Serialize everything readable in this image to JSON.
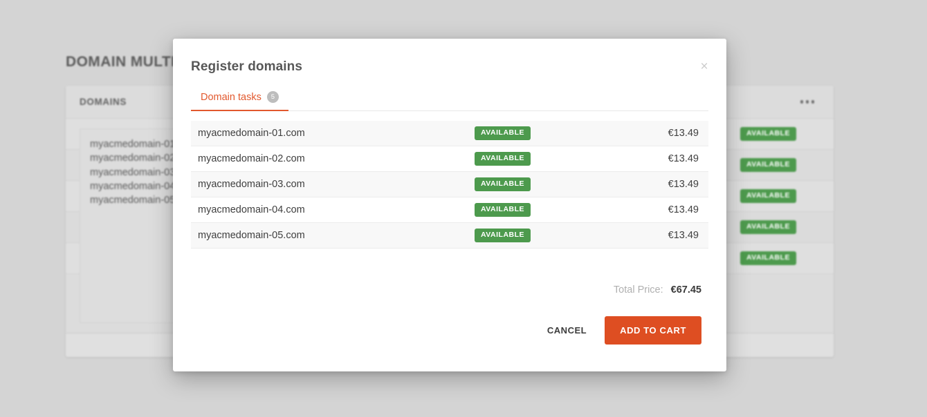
{
  "background": {
    "page_title": "DOMAIN MULTISEARCH",
    "card": {
      "header_title": "DOMAINS",
      "menu_icon": "ellipsis-horizontal-icon",
      "textarea_value": "myacmedomain-01.com\nmyacmedomain-02.com\nmyacmedomain-03.com\nmyacmedomain-04.com\nmyacmedomain-05.com",
      "rows": [
        {
          "status": "AVAILABLE"
        },
        {
          "status": "AVAILABLE"
        },
        {
          "status": "AVAILABLE"
        },
        {
          "status": "AVAILABLE"
        },
        {
          "status": "AVAILABLE"
        }
      ]
    }
  },
  "modal": {
    "title": "Register domains",
    "close_icon": "close-icon",
    "close_label": "×",
    "tabs": [
      {
        "label": "Domain tasks",
        "badge": "5",
        "active": true
      }
    ],
    "table": {
      "rows": [
        {
          "domain": "myacmedomain-01.com",
          "status": "AVAILABLE",
          "price": "€13.49"
        },
        {
          "domain": "myacmedomain-02.com",
          "status": "AVAILABLE",
          "price": "€13.49"
        },
        {
          "domain": "myacmedomain-03.com",
          "status": "AVAILABLE",
          "price": "€13.49"
        },
        {
          "domain": "myacmedomain-04.com",
          "status": "AVAILABLE",
          "price": "€13.49"
        },
        {
          "domain": "myacmedomain-05.com",
          "status": "AVAILABLE",
          "price": "€13.49"
        }
      ]
    },
    "total": {
      "label": "Total Price:",
      "value": "€67.45"
    },
    "footer": {
      "cancel_label": "CANCEL",
      "submit_label": "ADD TO CART"
    }
  },
  "colors": {
    "accent": "#de4e22",
    "tab_active": "#e2582d",
    "available_green": "#4d9a4d",
    "page_background": "#d4d4d4",
    "badge_grey": "#bdbdbd"
  }
}
